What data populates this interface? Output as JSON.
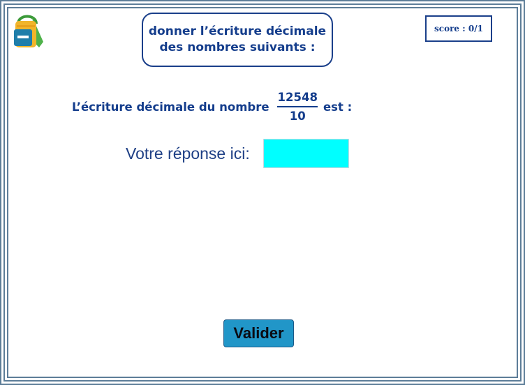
{
  "header": {
    "title_line1": "donner l’écriture décimale",
    "title_line2": "des nombres suivants :",
    "score": "score : 0/1"
  },
  "icons": {
    "logo": "schoolbag-icon"
  },
  "question": {
    "prefix": "L’écriture décimale du nombre",
    "numerator": "12548",
    "denominator": "10",
    "suffix": "est :"
  },
  "answer": {
    "label": "Votre réponse ici:",
    "value": ""
  },
  "actions": {
    "submit_label": "Valider"
  },
  "colors": {
    "accent": "#143d8c",
    "input_bg": "#00ffff",
    "button_bg": "#2196c8",
    "frame": "#5d7d98"
  }
}
